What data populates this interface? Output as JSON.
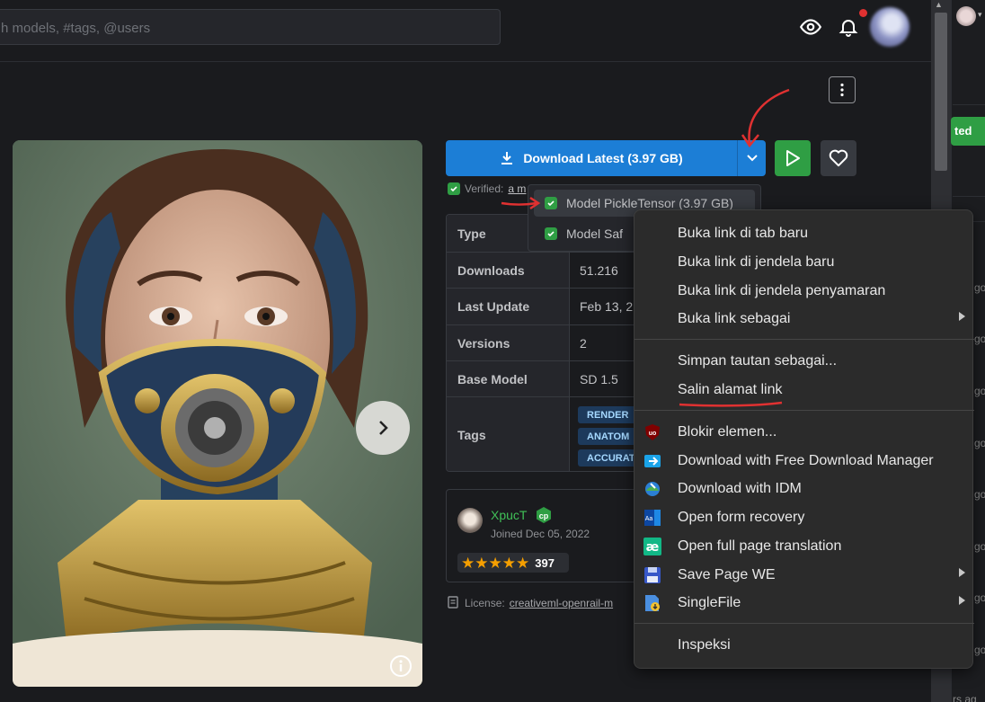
{
  "header": {
    "search_placeholder": "h models, #tags, @users"
  },
  "actions": {
    "download_label": "Download Latest (3.97 GB)",
    "verified_label": "Verified:",
    "verified_link": "a m"
  },
  "download_menu": {
    "items": [
      {
        "label": "Model PickleTensor (3.97 GB)"
      },
      {
        "label": "Model Saf"
      }
    ]
  },
  "details": {
    "rows": [
      {
        "label": "Type",
        "value": ""
      },
      {
        "label": "Downloads",
        "value": "51.216"
      },
      {
        "label": "Last Update",
        "value": "Feb 13, 2"
      },
      {
        "label": "Versions",
        "value": "2"
      },
      {
        "label": "Base Model",
        "value": "SD 1.5"
      },
      {
        "label": "Tags",
        "value": ""
      }
    ],
    "tags": [
      "RENDER",
      "ANATOM",
      "ACCURAT"
    ]
  },
  "creator": {
    "name": "XpucT",
    "joined": "Joined Dec 05, 2022",
    "rating": 5,
    "rating_count": "397"
  },
  "license": {
    "label": "License:",
    "value": "creativeml-openrail-m"
  },
  "context_menu": {
    "items": [
      {
        "label": "Buka link di tab baru"
      },
      {
        "label": "Buka link di jendela baru"
      },
      {
        "label": "Buka link di jendela penyamaran"
      },
      {
        "label": "Buka link sebagai"
      },
      {
        "label": "Simpan tautan sebagai..."
      },
      {
        "label": "Salin alamat link"
      },
      {
        "label": "Blokir elemen..."
      },
      {
        "label": "Download with Free Download Manager"
      },
      {
        "label": "Download with IDM"
      },
      {
        "label": "Open form recovery"
      },
      {
        "label": "Open full page translation"
      },
      {
        "label": "Save Page WE"
      },
      {
        "label": "SingleFile"
      },
      {
        "label": "Inspeksi"
      }
    ]
  },
  "side_strip": {
    "button_label": "ted",
    "snippets": [
      "go",
      "go",
      "go",
      "go",
      "go",
      "go",
      "go",
      "go",
      "go",
      "go",
      "go",
      "rs ag"
    ]
  },
  "colors": {
    "primary": "#1c7ed6",
    "success": "#2f9e44",
    "annotation": "#e03131"
  }
}
